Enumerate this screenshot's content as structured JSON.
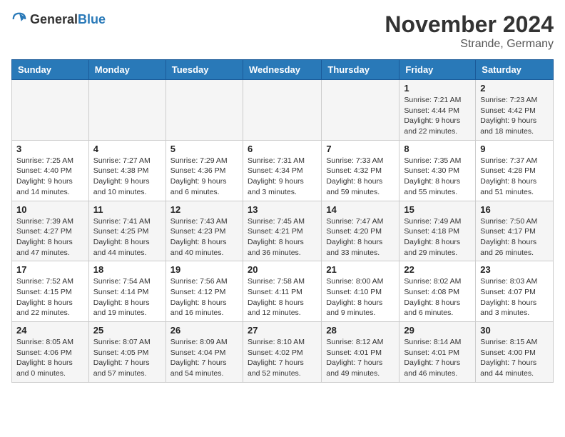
{
  "header": {
    "logo_general": "General",
    "logo_blue": "Blue",
    "month_title": "November 2024",
    "location": "Strande, Germany"
  },
  "days_of_week": [
    "Sunday",
    "Monday",
    "Tuesday",
    "Wednesday",
    "Thursday",
    "Friday",
    "Saturday"
  ],
  "weeks": [
    [
      {
        "day": "",
        "info": ""
      },
      {
        "day": "",
        "info": ""
      },
      {
        "day": "",
        "info": ""
      },
      {
        "day": "",
        "info": ""
      },
      {
        "day": "",
        "info": ""
      },
      {
        "day": "1",
        "info": "Sunrise: 7:21 AM\nSunset: 4:44 PM\nDaylight: 9 hours and 22 minutes."
      },
      {
        "day": "2",
        "info": "Sunrise: 7:23 AM\nSunset: 4:42 PM\nDaylight: 9 hours and 18 minutes."
      }
    ],
    [
      {
        "day": "3",
        "info": "Sunrise: 7:25 AM\nSunset: 4:40 PM\nDaylight: 9 hours and 14 minutes."
      },
      {
        "day": "4",
        "info": "Sunrise: 7:27 AM\nSunset: 4:38 PM\nDaylight: 9 hours and 10 minutes."
      },
      {
        "day": "5",
        "info": "Sunrise: 7:29 AM\nSunset: 4:36 PM\nDaylight: 9 hours and 6 minutes."
      },
      {
        "day": "6",
        "info": "Sunrise: 7:31 AM\nSunset: 4:34 PM\nDaylight: 9 hours and 3 minutes."
      },
      {
        "day": "7",
        "info": "Sunrise: 7:33 AM\nSunset: 4:32 PM\nDaylight: 8 hours and 59 minutes."
      },
      {
        "day": "8",
        "info": "Sunrise: 7:35 AM\nSunset: 4:30 PM\nDaylight: 8 hours and 55 minutes."
      },
      {
        "day": "9",
        "info": "Sunrise: 7:37 AM\nSunset: 4:28 PM\nDaylight: 8 hours and 51 minutes."
      }
    ],
    [
      {
        "day": "10",
        "info": "Sunrise: 7:39 AM\nSunset: 4:27 PM\nDaylight: 8 hours and 47 minutes."
      },
      {
        "day": "11",
        "info": "Sunrise: 7:41 AM\nSunset: 4:25 PM\nDaylight: 8 hours and 44 minutes."
      },
      {
        "day": "12",
        "info": "Sunrise: 7:43 AM\nSunset: 4:23 PM\nDaylight: 8 hours and 40 minutes."
      },
      {
        "day": "13",
        "info": "Sunrise: 7:45 AM\nSunset: 4:21 PM\nDaylight: 8 hours and 36 minutes."
      },
      {
        "day": "14",
        "info": "Sunrise: 7:47 AM\nSunset: 4:20 PM\nDaylight: 8 hours and 33 minutes."
      },
      {
        "day": "15",
        "info": "Sunrise: 7:49 AM\nSunset: 4:18 PM\nDaylight: 8 hours and 29 minutes."
      },
      {
        "day": "16",
        "info": "Sunrise: 7:50 AM\nSunset: 4:17 PM\nDaylight: 8 hours and 26 minutes."
      }
    ],
    [
      {
        "day": "17",
        "info": "Sunrise: 7:52 AM\nSunset: 4:15 PM\nDaylight: 8 hours and 22 minutes."
      },
      {
        "day": "18",
        "info": "Sunrise: 7:54 AM\nSunset: 4:14 PM\nDaylight: 8 hours and 19 minutes."
      },
      {
        "day": "19",
        "info": "Sunrise: 7:56 AM\nSunset: 4:12 PM\nDaylight: 8 hours and 16 minutes."
      },
      {
        "day": "20",
        "info": "Sunrise: 7:58 AM\nSunset: 4:11 PM\nDaylight: 8 hours and 12 minutes."
      },
      {
        "day": "21",
        "info": "Sunrise: 8:00 AM\nSunset: 4:10 PM\nDaylight: 8 hours and 9 minutes."
      },
      {
        "day": "22",
        "info": "Sunrise: 8:02 AM\nSunset: 4:08 PM\nDaylight: 8 hours and 6 minutes."
      },
      {
        "day": "23",
        "info": "Sunrise: 8:03 AM\nSunset: 4:07 PM\nDaylight: 8 hours and 3 minutes."
      }
    ],
    [
      {
        "day": "24",
        "info": "Sunrise: 8:05 AM\nSunset: 4:06 PM\nDaylight: 8 hours and 0 minutes."
      },
      {
        "day": "25",
        "info": "Sunrise: 8:07 AM\nSunset: 4:05 PM\nDaylight: 7 hours and 57 minutes."
      },
      {
        "day": "26",
        "info": "Sunrise: 8:09 AM\nSunset: 4:04 PM\nDaylight: 7 hours and 54 minutes."
      },
      {
        "day": "27",
        "info": "Sunrise: 8:10 AM\nSunset: 4:02 PM\nDaylight: 7 hours and 52 minutes."
      },
      {
        "day": "28",
        "info": "Sunrise: 8:12 AM\nSunset: 4:01 PM\nDaylight: 7 hours and 49 minutes."
      },
      {
        "day": "29",
        "info": "Sunrise: 8:14 AM\nSunset: 4:01 PM\nDaylight: 7 hours and 46 minutes."
      },
      {
        "day": "30",
        "info": "Sunrise: 8:15 AM\nSunset: 4:00 PM\nDaylight: 7 hours and 44 minutes."
      }
    ]
  ]
}
